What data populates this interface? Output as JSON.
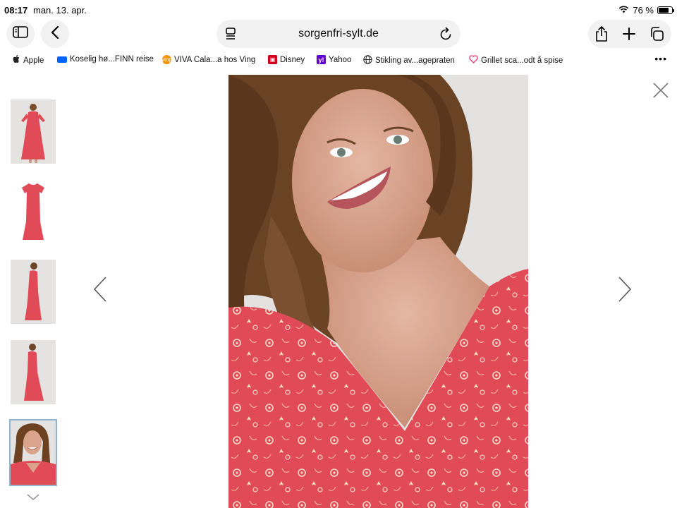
{
  "status_bar": {
    "time": "08:17",
    "date": "man. 13. apr.",
    "battery_text": "76 %",
    "battery_level": 0.76
  },
  "toolbar": {
    "url": "sorgenfri-sylt.de"
  },
  "bookmarks": [
    {
      "label": "Apple",
      "icon": "apple-icon"
    },
    {
      "label": "Koselig hø...FINN reise",
      "icon": "finn-icon",
      "color": "#0063fb"
    },
    {
      "label": "VIVA Cala...a hos Ving",
      "icon": "ving-icon",
      "color": "#f39200"
    },
    {
      "label": "Disney",
      "icon": "disney-icon",
      "color": "#d0021b"
    },
    {
      "label": "Yahoo",
      "icon": "yahoo-icon",
      "color": "#6001d2"
    },
    {
      "label": "Stikling av...agepraten",
      "icon": "globe-icon"
    },
    {
      "label": "Grillet sca...odt å spise",
      "icon": "heart-icon",
      "color": "#e8467c"
    }
  ],
  "gallery": {
    "thumbnails": [
      "model-full-front",
      "dress-flat",
      "model-side",
      "model-side-2",
      "model-closeup"
    ],
    "active_index": 4
  },
  "colors": {
    "dress_red": "#e14b57",
    "toolbar_bg": "#f2f2f2",
    "active_outline": "#8fb3d1"
  }
}
